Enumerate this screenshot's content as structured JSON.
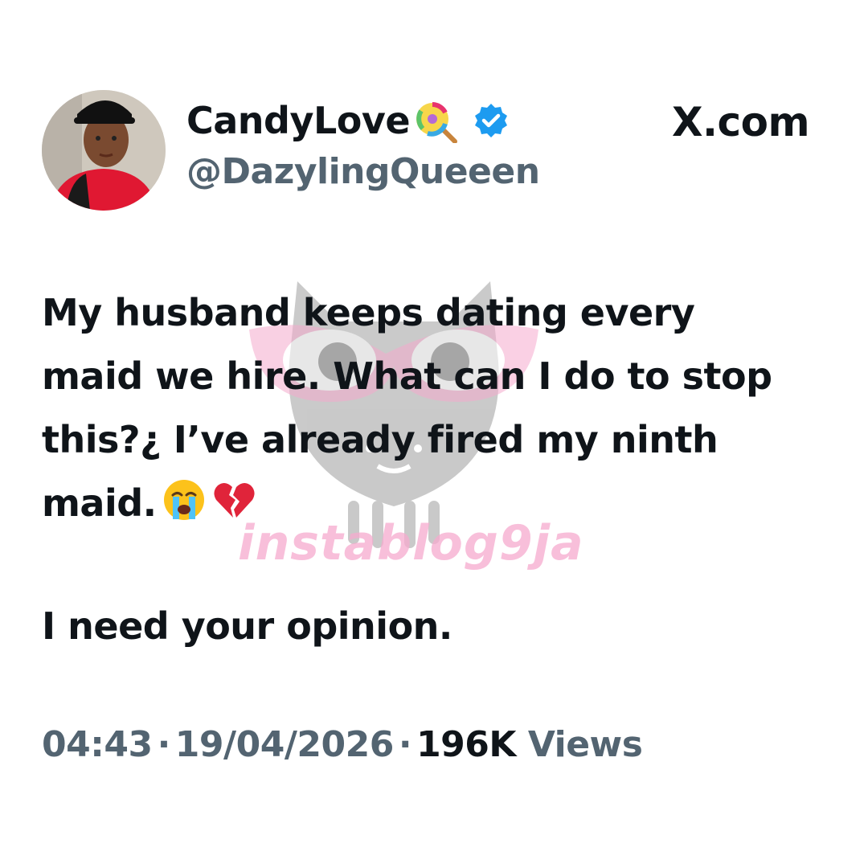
{
  "header": {
    "display_name": "CandyLove",
    "name_emoji": "lollipop-emoji",
    "verified_icon": "verified-badge-icon",
    "handle": "@DazylingQueeen",
    "site_label": "X.com"
  },
  "tweet": {
    "lines": [
      "My husband keeps dating every",
      "maid we hire. What can I do to stop",
      "this?¿ I’ve already fired my ninth",
      "maid."
    ],
    "emojis": [
      "loudly-crying-face-emoji",
      "broken-heart-emoji"
    ],
    "second_paragraph": "I need your opinion."
  },
  "meta": {
    "time": "04:43",
    "date": "19/04/2026",
    "separator": "·",
    "views_count": "196K",
    "views_label": "Views"
  },
  "watermark": {
    "text": "instablog9ja",
    "icon": "owl-glasses-icon"
  },
  "colors": {
    "text_primary": "#0f1419",
    "text_secondary": "#536471",
    "verified_blue": "#1d9bf0",
    "watermark_pink": "#f5aacd",
    "watermark_gray": "#8a8a8a"
  }
}
